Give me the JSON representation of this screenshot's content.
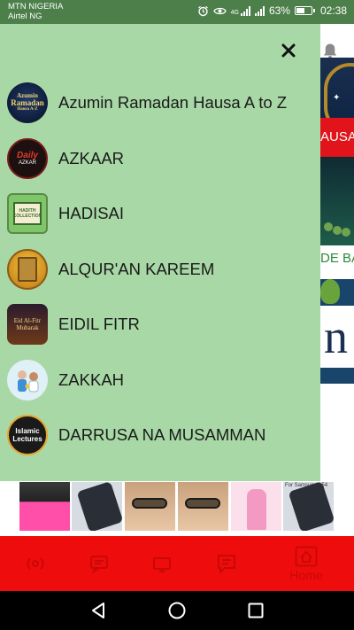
{
  "status_bar": {
    "carrier_1": "MTN NIGERIA",
    "carrier_2": "Airtel NG",
    "battery_percent": "63%",
    "battery_level": 0.63,
    "network_type": "4G",
    "time": "02:38"
  },
  "drawer": {
    "close_icon": "close-icon",
    "items": [
      {
        "label": "Azumin Ramadan Hausa A to Z",
        "icon": "ramadan-app-icon"
      },
      {
        "label": "AZKAAR",
        "icon": "daily-azkar-icon"
      },
      {
        "label": "HADISAI",
        "icon": "hadith-collection-icon"
      },
      {
        "label": "ALQUR'AN KAREEM",
        "icon": "quran-icon"
      },
      {
        "label": "EIDIL FITR",
        "icon": "eid-mubarak-icon"
      },
      {
        "label": "ZAKKAH",
        "icon": "zakkah-icon"
      },
      {
        "label": "DARRUSA NA MUSAMMAN",
        "icon": "islamic-lectures-icon"
      }
    ],
    "icon_text": {
      "ramadan": [
        "Azumin",
        "Ramadan",
        "Hausa A-Z"
      ],
      "azkar": [
        "Daily",
        "AZKAR"
      ],
      "hadith": [
        "HADITH",
        "COLLECTION"
      ],
      "eid": [
        "Eid Al-Fitr",
        "Mubarak"
      ],
      "lectures": [
        "Islamic",
        "Lectures"
      ]
    }
  },
  "background": {
    "red_label": "AUSA",
    "green_text": "DE BA",
    "big_letter": "n"
  },
  "ad_banner": {
    "caption": "For Samsung A54"
  },
  "bottom_nav": {
    "items": [
      {
        "icon": "radio-icon"
      },
      {
        "icon": "chat-icon"
      },
      {
        "icon": "tv-icon"
      },
      {
        "icon": "message-icon"
      },
      {
        "icon": "home-icon",
        "label": "Home"
      }
    ]
  },
  "system_nav": {
    "back": "back-icon",
    "home": "home-circle-icon",
    "recents": "recents-icon"
  }
}
